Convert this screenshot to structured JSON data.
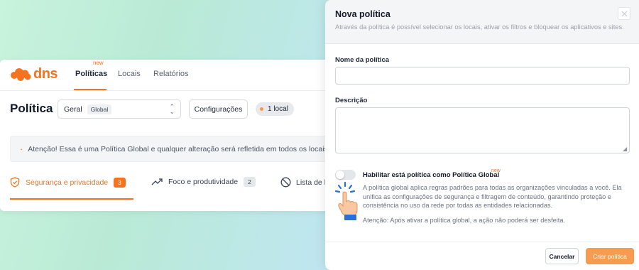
{
  "app": {
    "logo_text": "dns",
    "nav": {
      "items": [
        {
          "label": "Políticas",
          "badge": "new"
        },
        {
          "label": "Locais"
        },
        {
          "label": "Relatórios"
        }
      ]
    },
    "page_title": "Política",
    "policy_select": {
      "value": "Geral",
      "badge": "Global"
    },
    "config_button": "Configurações",
    "local_chip": "1 local",
    "warning_text": "Atenção! Essa é uma Política Global e qualquer alteração será refletida em todos os locais v",
    "tabs": [
      {
        "label": "Segurança e privacidade",
        "count": "3"
      },
      {
        "label": "Foco e produtividade",
        "count": "2"
      },
      {
        "label": "Lista de b"
      }
    ],
    "colors": {
      "accent": "#f47321"
    }
  },
  "modal": {
    "title": "Nova política",
    "subtitle": "Através da política é possível selecionar os locais, ativar os filtros e bloquear os aplicativos e sites.",
    "name_label": "Nome da política",
    "name_value": "",
    "description_label": "Descrição",
    "description_value": "",
    "toggle_label": "Habilitar está política como Política Global",
    "toggle_badge": "new",
    "toggle_on": false,
    "toggle_description": "A política global aplica regras padrões para todas as organizações vinculadas a você. Ela unifica as configurações de segurança e filtragem de conteúdo, garantindo proteção e consistência no uso da rede por todas as entidades relacionadas.",
    "toggle_warning": "Atenção: Após ativar a política global, a ação não poderá ser desfeita.",
    "cancel_label": "Cancelar",
    "create_label": "Criar política"
  }
}
